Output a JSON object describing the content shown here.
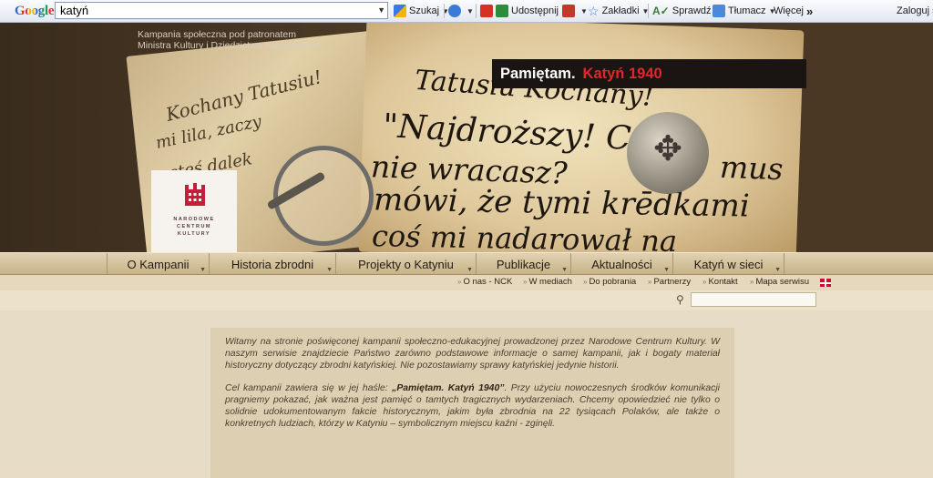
{
  "toolbar": {
    "logo": "Google",
    "search_value": "katyń",
    "search_button": "Szukaj",
    "share_label": "Udostępnij",
    "bookmarks_label": "Zakładki",
    "check_label": "Sprawdź",
    "translate_label": "Tłumacz",
    "more_label": "Więcej",
    "more_arrows": "»",
    "login_label": "Zaloguj si"
  },
  "header": {
    "patronat_line1": "Kampania społeczna pod patronatem",
    "patronat_line2": "Ministra Kultury i Dziedzictwa Narodowego",
    "tagline_part1": "Pamiętam.",
    "tagline_part2": "Katyń 1940",
    "logo_line1": "NARODOWE",
    "logo_line2": "CENTRUM",
    "logo_line3": "KULTURY"
  },
  "main_nav": [
    {
      "label": "O Kampanii"
    },
    {
      "label": "Historia zbrodni"
    },
    {
      "label": "Projekty o Katyniu"
    },
    {
      "label": "Publikacje"
    },
    {
      "label": "Aktualności"
    },
    {
      "label": "Katyń w sieci"
    }
  ],
  "sub_nav": [
    {
      "label": "O nas - NCK"
    },
    {
      "label": "W mediach"
    },
    {
      "label": "Do pobrania"
    },
    {
      "label": "Partnerzy"
    },
    {
      "label": "Kontakt"
    },
    {
      "label": "Mapa serwisu"
    }
  ],
  "intro": {
    "p1": "Witamy na stronie poświęconej kampanii społeczno-edukacyjnej prowadzonej przez Narodowe Centrum Kultury. W naszym serwisie znajdziecie Państwo zarówno podstawowe informacje o samej kampanii, jak i bogaty materiał historyczny dotyczący zbrodni katyńskiej. Nie pozostawiamy sprawy katyńskiej jedynie historii.",
    "p2_before": "Cel kampanii zawiera się w jej haśle: ",
    "p2_slogan": "„Pamiętam. Katyń 1940”",
    "p2_after": ". Przy użyciu nowoczesnych środków komunikacji pragniemy pokazać, jak ważna jest pamięć o tamtych tragicznych wydarzeniach. Chcemy opowiedzieć nie tylko o solidnie udokumentowanym fakcie historycznym, jakim była zbrodnia na 22 tysiącach Polaków, ale także o konkretnych ludziach, którzy w Katyniu – symbolicznym miejscu kaźni - zginęli."
  },
  "colors": {
    "tag_red": "#e2262b",
    "header_dark": "#3a2c1c",
    "nav_beige": "#d6c49e"
  }
}
